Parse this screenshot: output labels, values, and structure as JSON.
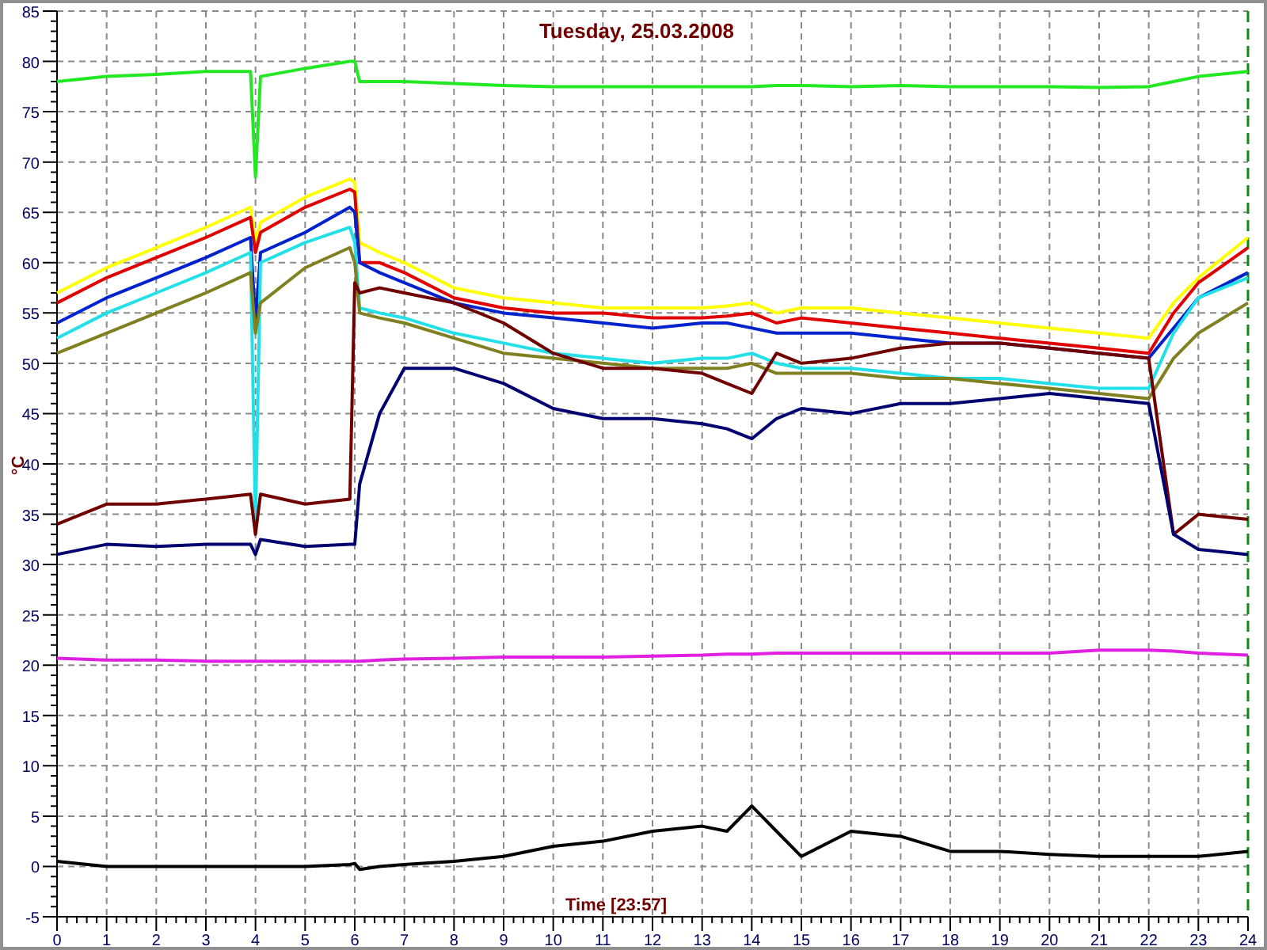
{
  "plot": {
    "chart_data": {
      "type": "line",
      "title": "Tuesday, 25.03.2008",
      "xlabel": "Time [23:57]",
      "ylabel": "°C",
      "x": [
        0,
        1,
        2,
        3,
        3.9,
        4,
        4.1,
        5,
        5.9,
        6,
        6.1,
        6.5,
        7,
        8,
        9,
        10,
        11,
        12,
        13,
        13.5,
        14,
        14.5,
        15,
        16,
        17,
        18,
        19,
        20,
        21,
        22,
        22.5,
        23,
        24
      ],
      "xlim": [
        0,
        24
      ],
      "ylim": [
        -5,
        85
      ],
      "grid": true,
      "xticks": [
        0,
        1,
        2,
        3,
        4,
        5,
        6,
        7,
        8,
        9,
        10,
        11,
        12,
        13,
        14,
        15,
        16,
        17,
        18,
        19,
        20,
        21,
        22,
        23,
        24
      ],
      "yticks": [
        -5,
        0,
        5,
        10,
        15,
        20,
        25,
        30,
        35,
        40,
        45,
        50,
        55,
        60,
        65,
        70,
        75,
        80,
        85
      ],
      "series": [
        {
          "color": "#22e822",
          "values": [
            78,
            78.5,
            78.7,
            79,
            79,
            68.5,
            78.5,
            79.3,
            80,
            80,
            78,
            78,
            78,
            77.8,
            77.6,
            77.5,
            77.5,
            77.5,
            77.5,
            77.5,
            77.5,
            77.6,
            77.6,
            77.5,
            77.6,
            77.5,
            77.5,
            77.5,
            77.4,
            77.5,
            78,
            78.5,
            79
          ]
        },
        {
          "color": "#ffff00",
          "values": [
            57,
            59.5,
            61.5,
            63.5,
            65.5,
            62,
            64,
            66.5,
            68.3,
            68,
            62,
            61,
            60,
            57.5,
            56.5,
            56,
            55.5,
            55.5,
            55.5,
            55.7,
            56,
            55,
            55.5,
            55.5,
            55,
            54.5,
            54,
            53.5,
            53,
            52.5,
            56,
            58.5,
            62.5
          ]
        },
        {
          "color": "#e00000",
          "values": [
            56,
            58.5,
            60.5,
            62.5,
            64.5,
            61,
            63,
            65.5,
            67.3,
            67,
            60,
            60,
            59,
            56.5,
            55.5,
            55,
            55,
            54.5,
            54.5,
            54.7,
            55,
            54,
            54.5,
            54,
            53.5,
            53,
            52.5,
            52,
            51.5,
            51,
            55,
            58,
            61.5
          ]
        },
        {
          "color": "#0022cc",
          "values": [
            54,
            56.5,
            58.5,
            60.5,
            62.5,
            54,
            61,
            63,
            65.5,
            65,
            60,
            59,
            58,
            56,
            55,
            54.5,
            54,
            53.5,
            54,
            54,
            53.5,
            53,
            53,
            53,
            52.5,
            52,
            52,
            51.5,
            51,
            50.5,
            53.5,
            56.5,
            59
          ]
        },
        {
          "color": "#22e0e8",
          "values": [
            52.5,
            55,
            57,
            59,
            61,
            34,
            60,
            62,
            63.5,
            62,
            55.5,
            55,
            54.5,
            53,
            52,
            51,
            50.5,
            50,
            50.5,
            50.5,
            51,
            50,
            49.5,
            49.5,
            49,
            48.5,
            48.5,
            48,
            47.5,
            47.5,
            53,
            56.5,
            58.5
          ]
        },
        {
          "color": "#808020",
          "values": [
            51,
            53,
            55,
            57,
            59,
            53,
            56,
            59.5,
            61.5,
            60,
            55,
            54.5,
            54,
            52.5,
            51,
            50.5,
            50,
            49.5,
            49.5,
            49.5,
            50,
            49,
            49,
            49,
            48.5,
            48.5,
            48,
            47.5,
            47,
            46.5,
            50.5,
            53,
            56
          ]
        },
        {
          "color": "#700000",
          "values": [
            34,
            36,
            36,
            36.5,
            37,
            33,
            37,
            36,
            36.5,
            58,
            57,
            57.5,
            57,
            56,
            54,
            51,
            49.5,
            49.5,
            49,
            48,
            47,
            51,
            50,
            50.5,
            51.5,
            52,
            52,
            51.5,
            51,
            50.5,
            33,
            35,
            34.5
          ]
        },
        {
          "color": "#000070",
          "values": [
            31,
            32,
            31.8,
            32,
            32,
            31,
            32.5,
            31.8,
            32,
            32,
            38,
            45,
            49.5,
            49.5,
            48,
            45.5,
            44.5,
            44.5,
            44,
            43.5,
            42.5,
            44.5,
            45.5,
            45,
            46,
            46,
            46.5,
            47,
            46.5,
            46,
            33,
            31.5,
            31
          ]
        },
        {
          "color": "#e020e0",
          "values": [
            20.7,
            20.5,
            20.5,
            20.4,
            20.4,
            20.4,
            20.4,
            20.4,
            20.4,
            20.4,
            20.4,
            20.5,
            20.6,
            20.7,
            20.8,
            20.8,
            20.8,
            20.9,
            21,
            21.1,
            21.1,
            21.2,
            21.2,
            21.2,
            21.2,
            21.2,
            21.2,
            21.2,
            21.5,
            21.5,
            21.4,
            21.2,
            21
          ]
        },
        {
          "color": "#000000",
          "values": [
            0.5,
            0,
            0,
            0,
            0,
            0,
            0,
            0,
            0.2,
            0.3,
            -0.3,
            0,
            0.2,
            0.5,
            1,
            2,
            2.5,
            3.5,
            4,
            3.5,
            6,
            3.5,
            1,
            3.5,
            3,
            1.5,
            1.5,
            1.2,
            1,
            1,
            1,
            1,
            1.5
          ]
        }
      ]
    }
  }
}
